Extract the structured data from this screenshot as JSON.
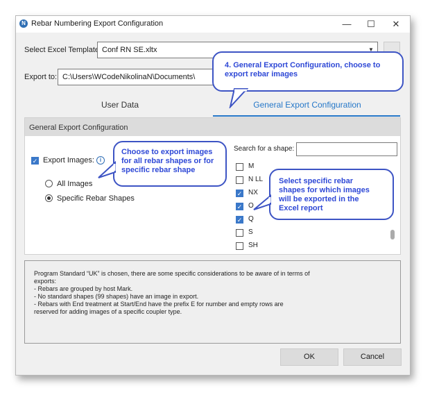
{
  "window": {
    "title": "Rebar Numbering Export Configuration",
    "app_icon": "N"
  },
  "controls": {
    "minimize": "—",
    "maximize": "☐",
    "close": "✕"
  },
  "template": {
    "label": "Select Excel Template:",
    "value": "Conf RN SE.xltx"
  },
  "export": {
    "label": "Export to:",
    "path": "C:\\Users\\WCodeNikolinaN\\Documents\\"
  },
  "tabs": [
    {
      "label": "User Data",
      "active": false
    },
    {
      "label": "General Export Configuration",
      "active": true
    }
  ],
  "section": {
    "header": "General Export Configuration",
    "export_images": {
      "label": "Export Images:",
      "checked": true,
      "info_icon": "i"
    },
    "radios": [
      {
        "label": "All Images",
        "selected": false
      },
      {
        "label": "Specific Rebar Shapes",
        "selected": true
      }
    ],
    "search": {
      "label": "Search for a shape:",
      "value": ""
    },
    "shapes": [
      {
        "label": "M",
        "checked": false
      },
      {
        "label": "N LL",
        "checked": false
      },
      {
        "label": "NX",
        "checked": true
      },
      {
        "label": "O",
        "checked": true
      },
      {
        "label": "Q",
        "checked": true
      },
      {
        "label": "S",
        "checked": false
      },
      {
        "label": "SH",
        "checked": false
      }
    ]
  },
  "notes": {
    "lines": [
      "Program Standard “UK” is chosen, there are some specific considerations to be aware of in terms of",
      "exports:",
      "- Rebars are grouped by host Mark.",
      "- No standard shapes (99 shapes) have an image in export.",
      "- Rebars with End treatment at Start/End have the prefix E for number and empty rows are",
      "reserved for adding images of a specific coupler type."
    ]
  },
  "buttons": {
    "ok": "OK",
    "cancel": "Cancel"
  },
  "callouts": {
    "tab": [
      "4. General Export Configuration, choose to",
      "export rebar images"
    ],
    "images": [
      "Choose to export images",
      "for all rebar shapes or for",
      "specific rebar shape"
    ],
    "shapes": [
      "Select specific rebar",
      "shapes for which images",
      "will be exported in the",
      "Excel report"
    ]
  },
  "colors": {
    "accent": "#2577c8",
    "callout_text": "#2e48d6",
    "callout_border": "#3d54c4",
    "checkbox": "#3a78c9"
  }
}
